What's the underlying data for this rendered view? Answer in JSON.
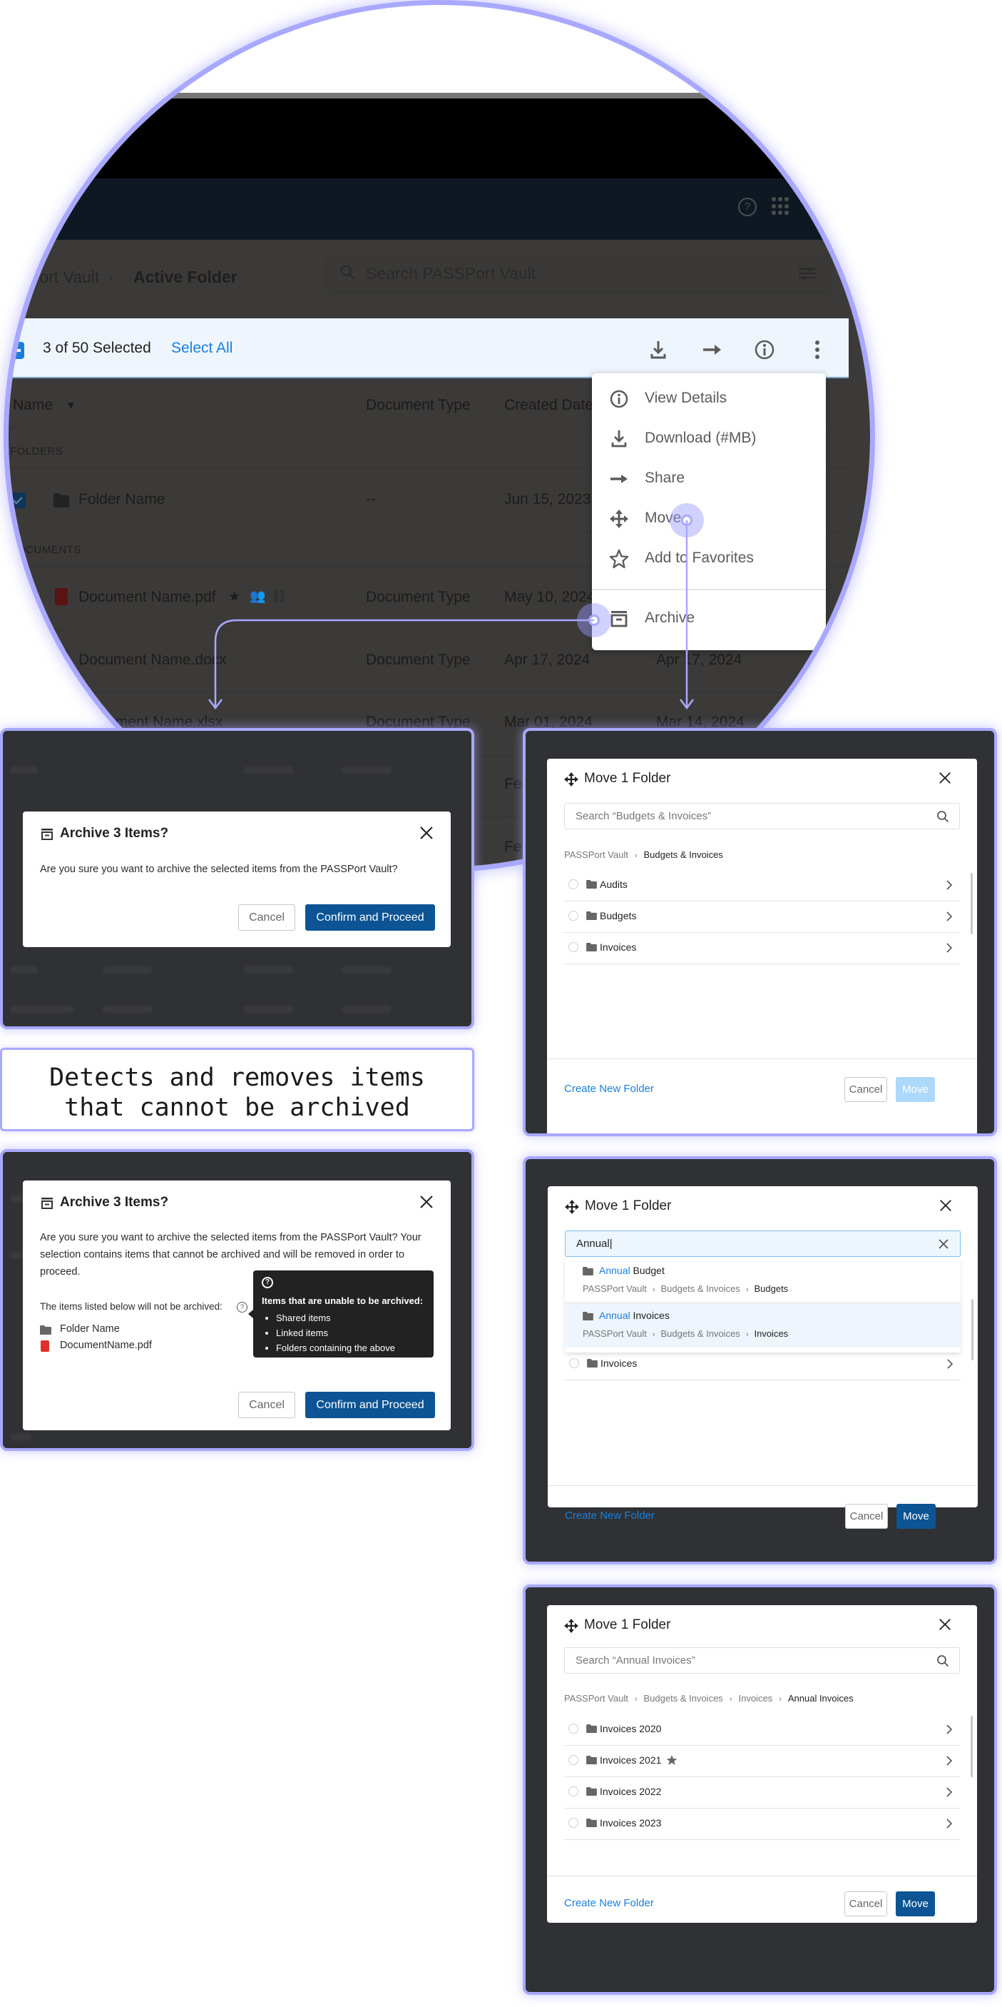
{
  "magnifier": {
    "breadcrumb": {
      "parent": "Port Vault",
      "current": "Active Folder"
    },
    "search_placeholder": "Search PASSPort Vault",
    "selection": {
      "count_label": "3 of 50 Selected",
      "select_all": "Select All"
    },
    "table": {
      "headers": {
        "name": "Name",
        "document_type": "Document Type",
        "created_date": "Created Date"
      },
      "sections": {
        "folders": "FOLDERS",
        "documents": "OCUMENTS"
      },
      "rows": [
        {
          "name": "Folder Name",
          "type": "--",
          "created": "Jun 15, 2023",
          "modified": ""
        },
        {
          "name": "Document Name.pdf",
          "type": "Document Type",
          "created": "May 10, 2024",
          "modified": ""
        },
        {
          "name": "Document Name.docx",
          "type": "Document Type",
          "created": "Apr 17, 2024",
          "modified": "Apr 17, 2024"
        },
        {
          "name": "ument Name.xlsx",
          "type": "Document Type",
          "created": "Mar 01, 2024",
          "modified": "Mar 14, 2024"
        },
        {
          "name": "",
          "type": "",
          "created": "",
          "modified": "Feb"
        },
        {
          "name": "",
          "type": "",
          "created": "",
          "modified": "Feb"
        }
      ]
    },
    "context_menu": [
      {
        "label": "View Details",
        "icon": "info-icon"
      },
      {
        "label": "Download (#MB)",
        "icon": "download-icon"
      },
      {
        "label": "Share",
        "icon": "arrow-right-icon"
      },
      {
        "label": "Move",
        "icon": "move-icon"
      },
      {
        "label": "Add to Favorites",
        "icon": "star-outline-icon"
      },
      {
        "label": "Archive",
        "icon": "archive-icon"
      }
    ]
  },
  "archive_dialog_1": {
    "title": "Archive 3 Items?",
    "body": "Are you sure you want to archive the selected items from the PASSPort Vault?",
    "cancel": "Cancel",
    "confirm": "Confirm and Proceed"
  },
  "caption": {
    "line1": "Detects and removes items",
    "line2": "that cannot be archived"
  },
  "archive_dialog_2": {
    "title": "Archive 3 Items?",
    "body": "Are you sure you want to archive the selected items from the PASSPort Vault? Your selection contains items that cannot be archived and will be removed in order to proceed.",
    "list_label": "The items listed below will not be archived:",
    "items": [
      {
        "name": "Folder Name",
        "icon": "folder-icon"
      },
      {
        "name": "DocumentName.pdf",
        "icon": "pdf-icon"
      }
    ],
    "tooltip": {
      "title": "Items that are unable to be archived:",
      "bullets": [
        "Shared items",
        "Linked items",
        "Folders containing the above"
      ]
    },
    "cancel": "Cancel",
    "confirm": "Confirm and Proceed"
  },
  "move_dialog_1": {
    "title": "Move 1 Folder",
    "search_placeholder": "Search “Budgets & Invoices”",
    "breadcrumb": [
      "PASSPort Vault",
      "Budgets & Invoices"
    ],
    "folders": [
      "Audits",
      "Budgets",
      "Invoices"
    ],
    "create": "Create New Folder",
    "cancel": "Cancel",
    "move": "Move",
    "move_enabled": false
  },
  "move_dialog_2": {
    "title": "Move 1 Folder",
    "search_value": "Annual|",
    "suggestions": [
      {
        "match": "Annual",
        "rest": " Budget",
        "path": [
          "PASSPort Vault",
          "Budgets & Invoices",
          "Budgets"
        ]
      },
      {
        "match": "Annual",
        "rest": " Invoices",
        "path": [
          "PASSPort Vault",
          "Budgets & Invoices",
          "Invoices"
        ],
        "highlighted": true
      }
    ],
    "folders": [
      "Invoices"
    ],
    "create": "Create New Folder",
    "cancel": "Cancel",
    "move": "Move",
    "move_enabled": true
  },
  "move_dialog_3": {
    "title": "Move 1 Folder",
    "search_placeholder": "Search “Annual Invoices”",
    "breadcrumb": [
      "PASSPort Vault",
      "Budgets & Invoices",
      "Invoices",
      "Annual Invoices"
    ],
    "folders": [
      {
        "name": "Invoices 2020",
        "favorite": false
      },
      {
        "name": "Invoices 2021",
        "favorite": true
      },
      {
        "name": "Invoices 2022",
        "favorite": false
      },
      {
        "name": "Invoices 2023",
        "favorite": false
      }
    ],
    "create": "Create New Folder",
    "cancel": "Cancel",
    "move": "Move",
    "move_enabled": true
  },
  "colors": {
    "accent": "#a9a8ff",
    "primary": "#0c5494",
    "link": "#1a7fdb",
    "disabled": "#acd8fb"
  }
}
